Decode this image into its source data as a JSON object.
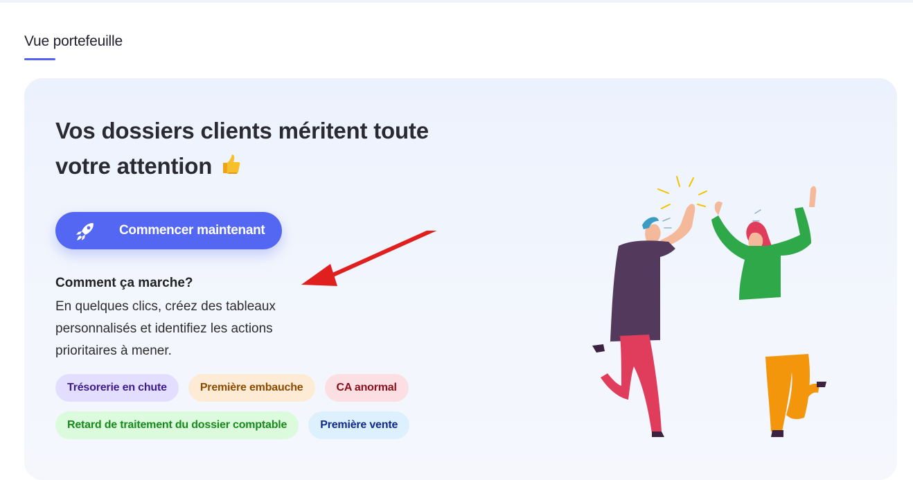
{
  "tabs": [
    {
      "label": "Vue portefeuille",
      "active": true
    }
  ],
  "card": {
    "headline": "Vos dossiers clients méritent toute votre attention",
    "headline_emoji": "thumbs-up-icon",
    "cta_label": "Commencer maintenant",
    "cta_icon": "rocket-icon",
    "how_title": "Comment ça marche?",
    "how_body": "En quelques clics, créez des tableaux personnalisés et identifiez les actions prioritaires à mener.",
    "tags_row1": [
      {
        "label": "Trésorerie en chute",
        "bg": "#e4defe",
        "fg": "#3c1a8c"
      },
      {
        "label": "Première embauche",
        "bg": "#fdebd6",
        "fg": "#8a4b00"
      },
      {
        "label": "CA anormal",
        "bg": "#fbdfe2",
        "fg": "#8a0f1c"
      }
    ],
    "tags_row2": [
      {
        "label": "Retard de traitement du dossier comptable",
        "bg": "#dbfbdc",
        "fg": "#178a1c"
      },
      {
        "label": "Première vente",
        "bg": "#dcf1fd",
        "fg": "#0f2a8a"
      }
    ]
  },
  "colors": {
    "accent": "#5467f2",
    "annotation_arrow": "#e0201f"
  }
}
